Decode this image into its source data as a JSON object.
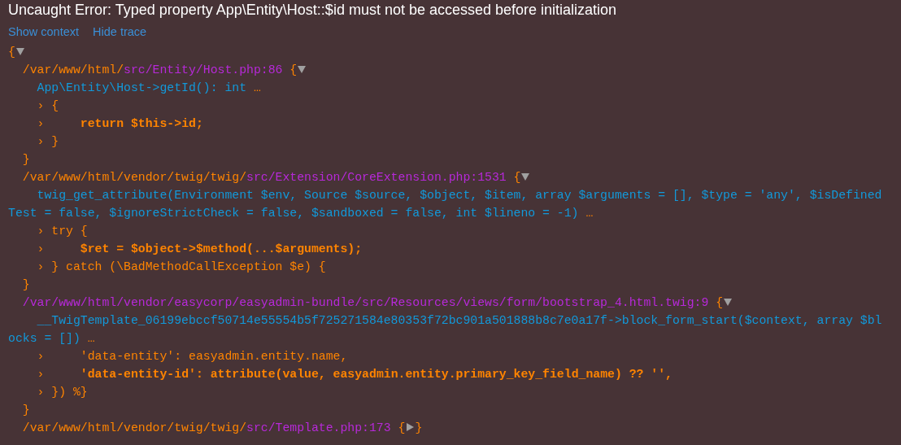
{
  "error": {
    "message": "Uncaught Error: Typed property App\\Entity\\Host::$id must not be accessed before initialization"
  },
  "links": [
    {
      "label": "Show context"
    },
    {
      "label": "Hide trace"
    }
  ],
  "trace": {
    "open": "{",
    "expanded": true,
    "frames": [
      {
        "prefix": "/var/www/html/",
        "file": "src/Entity/Host.php:86",
        "open": "{",
        "close": "}",
        "expanded": true,
        "signature": "App\\Entity\\Host->getId(): int",
        "ellipsis": "…",
        "lines": [
          {
            "marker": "›",
            "code": "{",
            "highlighted": false
          },
          {
            "marker": "›",
            "code": "    return $this->id;",
            "highlighted": true
          },
          {
            "marker": "›",
            "code": "}",
            "highlighted": false
          }
        ]
      },
      {
        "prefix": "/var/www/html/vendor/twig/twig/",
        "file": "src/Extension/CoreExtension.php:1531",
        "open": "{",
        "close": "}",
        "expanded": true,
        "signature": "twig_get_attribute(Environment $env, Source $source, $object, $item, array $arguments = [], $type = 'any', $isDefinedTest = false, $ignoreStrictCheck = false, $sandboxed = false, int $lineno = -1)",
        "ellipsis": "…",
        "lines": [
          {
            "marker": "›",
            "code": "try {",
            "highlighted": false
          },
          {
            "marker": "›",
            "code": "    $ret = $object->$method(...$arguments);",
            "highlighted": true
          },
          {
            "marker": "›",
            "code": "} catch (\\BadMethodCallException $e) {",
            "highlighted": false
          }
        ]
      },
      {
        "file": "/var/www/html/vendor/easycorp/easyadmin-bundle/src/Resources/views/form/bootstrap_4.html.twig:9",
        "open": "{",
        "close": "}",
        "expanded": true,
        "signature": "__TwigTemplate_06199ebccf50714e55554b5f725271584e80353f72bc901a501888b8c7e0a17f->block_form_start($context, array $blocks = [])",
        "ellipsis": "…",
        "lines": [
          {
            "marker": "›",
            "code": "    'data-entity': easyadmin.entity.name,",
            "highlighted": false
          },
          {
            "marker": "›",
            "code": "    'data-entity-id': attribute(value, easyadmin.entity.primary_key_field_name) ?? '',",
            "highlighted": true
          },
          {
            "marker": "›",
            "code": "}) %}",
            "highlighted": false
          }
        ]
      },
      {
        "prefix": "/var/www/html/vendor/twig/twig/",
        "file": "src/Template.php:173",
        "open": "{",
        "close": "}",
        "expanded": false
      }
    ]
  }
}
